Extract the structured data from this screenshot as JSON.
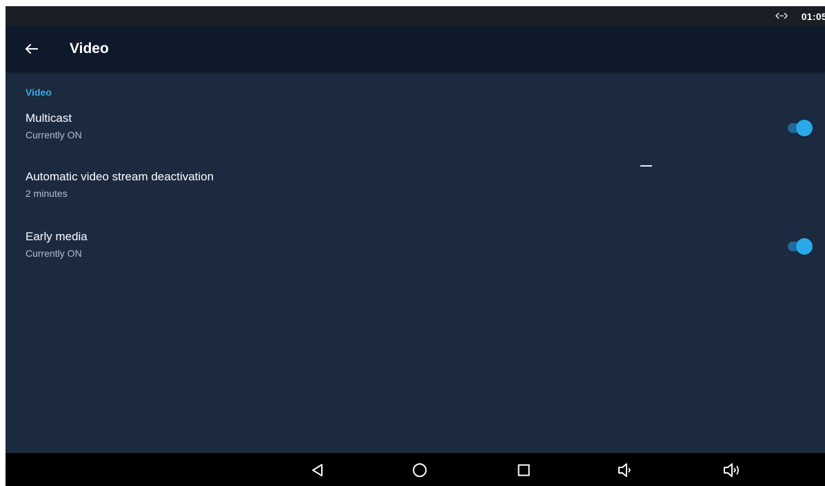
{
  "status_bar": {
    "time": "01:05",
    "network_icon": "data-transfer-icon"
  },
  "app_bar": {
    "back_icon": "arrow-left-icon",
    "title": "Video"
  },
  "section": {
    "header": "Video"
  },
  "preferences": [
    {
      "title": "Multicast",
      "summary": "Currently ON",
      "toggle_on": true
    },
    {
      "title": "Automatic video stream deactivation",
      "summary": "2 minutes"
    },
    {
      "title": "Early media",
      "summary": "Currently ON",
      "toggle_on": true
    }
  ],
  "nav_bar": {
    "buttons": [
      "back-triangle-icon",
      "home-circle-icon",
      "recents-square-icon",
      "volume-down-icon",
      "volume-up-icon"
    ]
  },
  "colors": {
    "accent": "#29a9ea",
    "background": "#1c2a40",
    "app_bar": "#0e1a2b",
    "section_header": "#2eaee8"
  }
}
